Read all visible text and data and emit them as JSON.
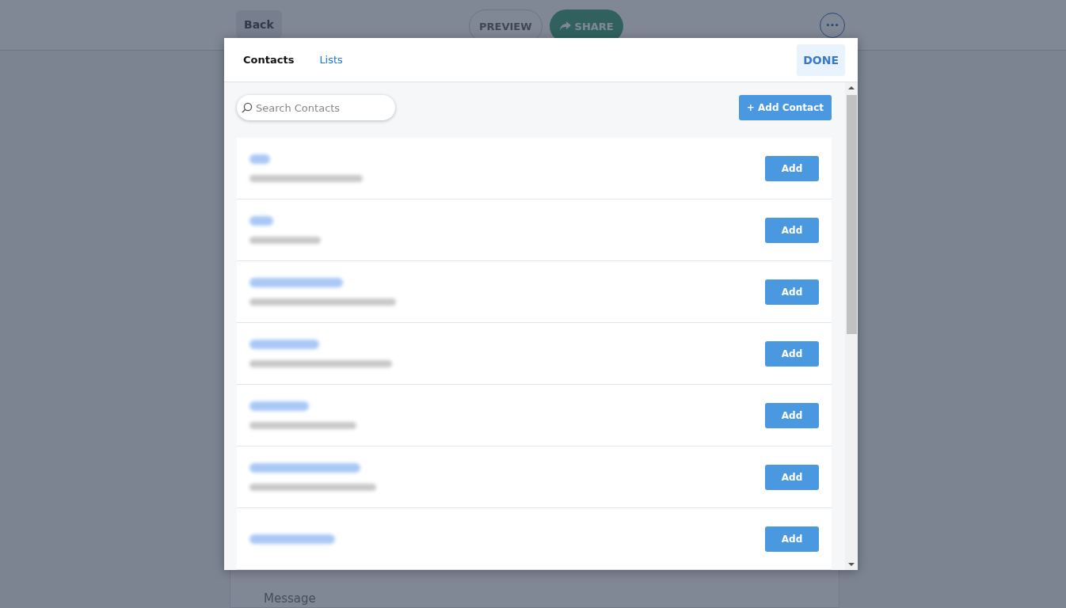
{
  "page": {
    "back": "Back",
    "preview": "PREVIEW",
    "share": "SHARE",
    "message_placeholder": "Message"
  },
  "modal": {
    "tabs": [
      {
        "label": "Contacts",
        "selected": true
      },
      {
        "label": "Lists",
        "selected": false
      }
    ],
    "done": "DONE",
    "search": {
      "placeholder": "Search Contacts"
    },
    "add_contact": "+ Add Contact",
    "contacts": [
      {
        "kind": "blurred",
        "has_email": true,
        "action": "Add"
      },
      {
        "kind": "blurred",
        "has_email": true,
        "action": "Add"
      },
      {
        "kind": "blurred",
        "has_email": true,
        "action": "Add"
      },
      {
        "kind": "blurred",
        "has_email": true,
        "action": "Add"
      },
      {
        "kind": "blurred",
        "has_email": true,
        "action": "Add"
      },
      {
        "kind": "blurred",
        "has_email": true,
        "action": "Add"
      },
      {
        "kind": "blurred",
        "has_email": false,
        "action": "Add"
      }
    ]
  }
}
